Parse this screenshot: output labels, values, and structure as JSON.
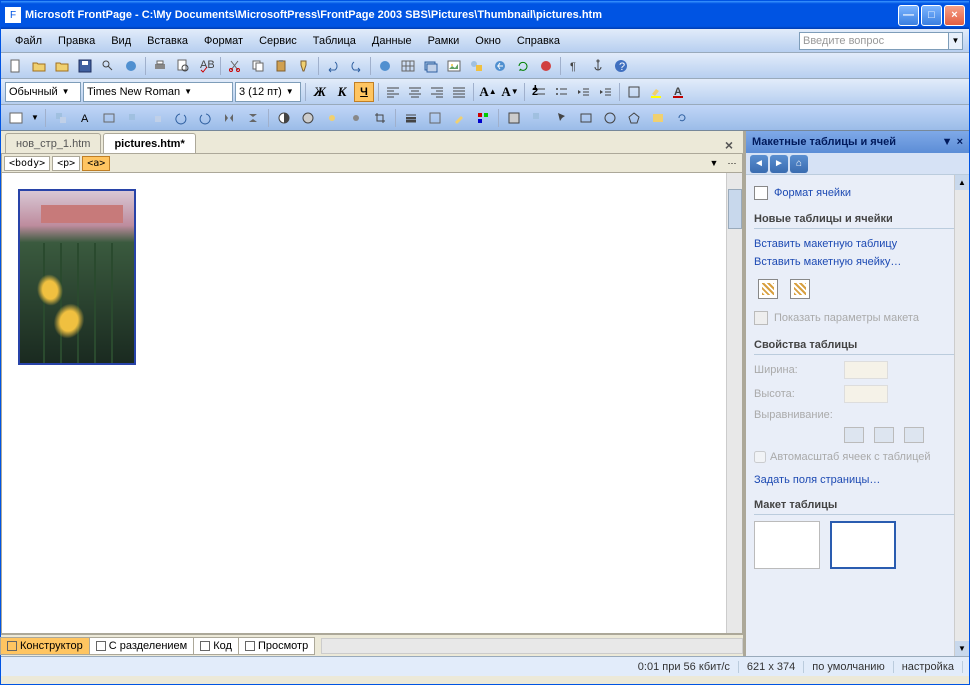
{
  "title": "Microsoft FrontPage - C:\\My Documents\\MicrosoftPress\\FrontPage 2003 SBS\\Pictures\\Thumbnail\\pictures.htm",
  "menus": [
    "Файл",
    "Правка",
    "Вид",
    "Вставка",
    "Формат",
    "Сервис",
    "Таблица",
    "Данные",
    "Рамки",
    "Окно",
    "Справка"
  ],
  "help_placeholder": "Введите вопрос",
  "format": {
    "style": "Обычный",
    "font": "Times New Roman",
    "size": "3 (12 пт)"
  },
  "tabs": [
    {
      "label": "нов_стр_1.htm",
      "active": false
    },
    {
      "label": "pictures.htm*",
      "active": true
    }
  ],
  "breadcrumbs": [
    "<body>",
    "<p>",
    "<a>"
  ],
  "viewtabs": [
    {
      "label": "Конструктор",
      "active": true
    },
    {
      "label": "С разделением",
      "active": false
    },
    {
      "label": "Код",
      "active": false
    },
    {
      "label": "Просмотр",
      "active": false
    }
  ],
  "taskpane": {
    "title": "Макетные таблицы и ячей",
    "format_cell": "Формат ячейки",
    "s1": "Новые таблицы и ячейки",
    "insert_table": "Вставить макетную таблицу",
    "insert_cell": "Вставить макетную ячейку…",
    "show_params": "Показать параметры макета",
    "s2": "Свойства таблицы",
    "width_label": "Ширина:",
    "height_label": "Высота:",
    "align_label": "Выравнивание:",
    "autoscale": "Автомасштаб ячеек с таблицей",
    "margins": "Задать поля страницы…",
    "s3": "Макет таблицы"
  },
  "statusbar": {
    "speed": "0:01 при 56 кбит/с",
    "dims": "621 x 374",
    "mode": "по умолчанию",
    "custom": "настройка"
  }
}
